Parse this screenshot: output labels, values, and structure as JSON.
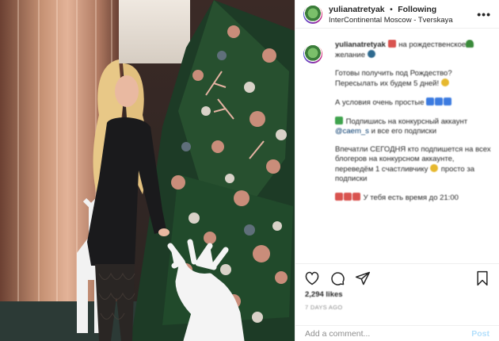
{
  "header": {
    "username": "yulianatretyak",
    "separator": "•",
    "follow_label": "Following",
    "location": "InterContinental Moscow - Tverskaya",
    "more_icon": "more-horizontal-icon"
  },
  "caption": {
    "username": "yulianatretyak",
    "p1": "на рождественское желание",
    "p2": "Готовы получить под Рождество? Пересылать их будем 5 дней!",
    "p3": "А условия очень простые",
    "p4a": "Подпишись на конкурсный аккаунт",
    "p4_link": "@caem_s",
    "p4b": "и все его подписки",
    "p5": "Впечатли СЕГОДНЯ кто подпишется на всех блогеров на конкурсном аккаунте, переведём 1 счастливчику",
    "p5b": "просто за подписки",
    "p6": "У тебя есть время до 21:00"
  },
  "actions": {
    "like_icon": "heart-icon",
    "comment_icon": "comment-icon",
    "share_icon": "share-icon",
    "save_icon": "bookmark-icon"
  },
  "likes_text": "2,294 likes",
  "time_text": "7 DAYS AGO",
  "comment": {
    "placeholder": "Add a comment...",
    "post_label": "Post"
  }
}
